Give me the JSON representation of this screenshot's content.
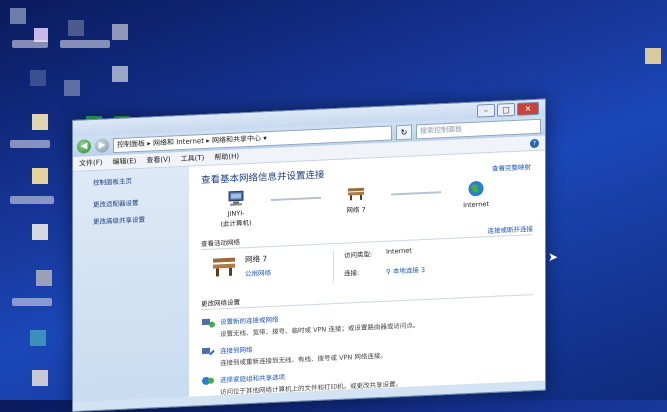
{
  "window": {
    "address_parts": [
      "控制面板",
      "网络和 Internet",
      "网络和共享中心"
    ],
    "search_placeholder": "搜索控制面板",
    "menu": [
      "文件(F)",
      "编辑(E)",
      "查看(V)",
      "工具(T)",
      "帮助(H)"
    ]
  },
  "sidebar": {
    "home": "控制面板主页",
    "links": [
      "更改适配器设置",
      "更改高级共享设置"
    ]
  },
  "main": {
    "heading": "查看基本网络信息并设置连接",
    "full_map_link": "查看完整映射",
    "map": {
      "computer_label": "JINYI-",
      "computer_sub": "(此计算机)",
      "network_label": "网络  7",
      "internet_label": "Internet"
    },
    "active_networks_header": "查看活动网络",
    "connect_link": "连接或断开连接",
    "network_name": "网络  7",
    "network_type": "公用网络",
    "access_type_label": "访问类型:",
    "access_type_value": "Internet",
    "connections_label": "连接:",
    "connections_value": "本地连接 3",
    "change_settings_header": "更改网络设置",
    "tasks": [
      {
        "title": "设置新的连接或网络",
        "desc": "设置无线、宽带、拨号、临时或 VPN 连接；或设置路由器或访问点。"
      },
      {
        "title": "连接到网络",
        "desc": "连接到或重新连接到无线、有线、拨号或 VPN 网络连接。"
      },
      {
        "title": "选择家庭组和共享选项",
        "desc": "访问位于其他网络计算机上的文件和打印机，或更改共享设置。"
      }
    ]
  }
}
